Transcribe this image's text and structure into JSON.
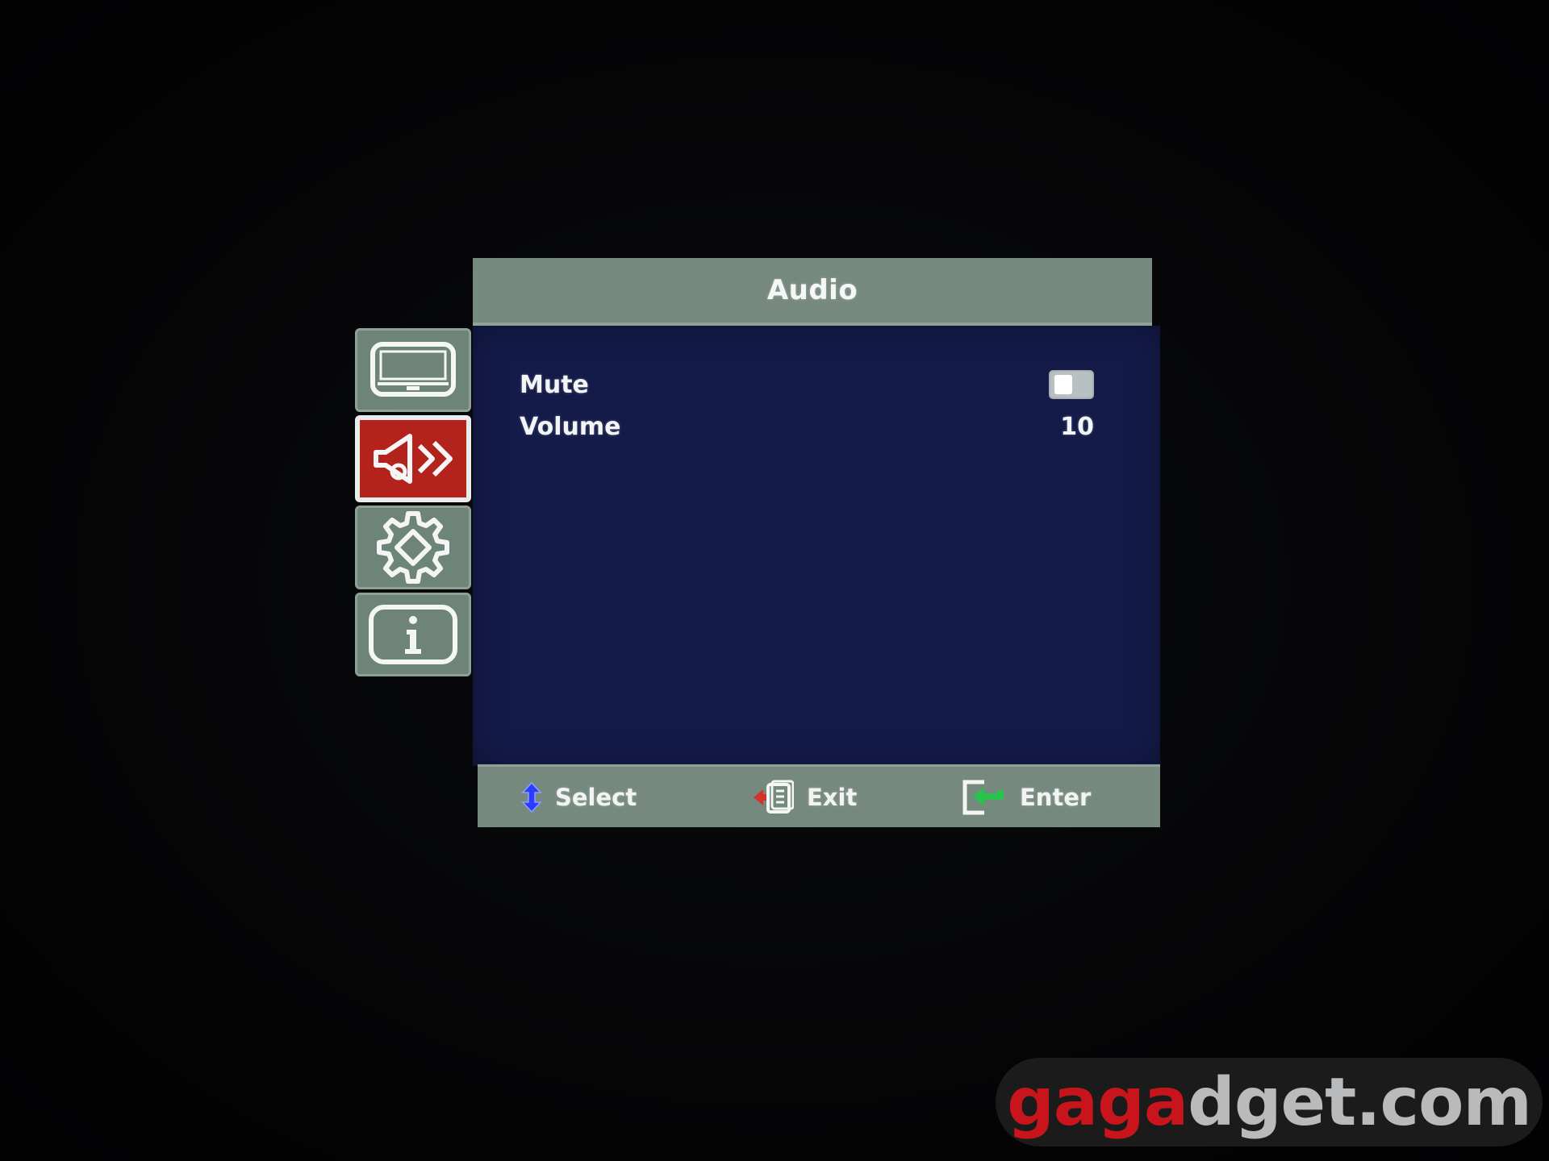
{
  "menu": {
    "title": "Audio",
    "tabs": [
      {
        "icon": "display-icon",
        "active": false
      },
      {
        "icon": "speaker-icon",
        "active": true
      },
      {
        "icon": "gear-icon",
        "active": false
      },
      {
        "icon": "info-icon",
        "active": false
      }
    ],
    "items": [
      {
        "label": "Mute",
        "type": "toggle",
        "on": false
      },
      {
        "label": "Volume",
        "type": "value",
        "value": "10"
      }
    ]
  },
  "footer": {
    "select_label": "Select",
    "exit_label": "Exit",
    "enter_label": "Enter"
  },
  "watermark": {
    "part1": "ga",
    "part2": "ga",
    "part3": "dget.com"
  },
  "colors": {
    "panel_body": "#141b49",
    "panel_frame": "#76897f",
    "active_tab": "#b3231c",
    "select_arrow": "#2a3cff",
    "enter_arrow": "#29c24d",
    "exit_arrow": "#d6322c"
  }
}
